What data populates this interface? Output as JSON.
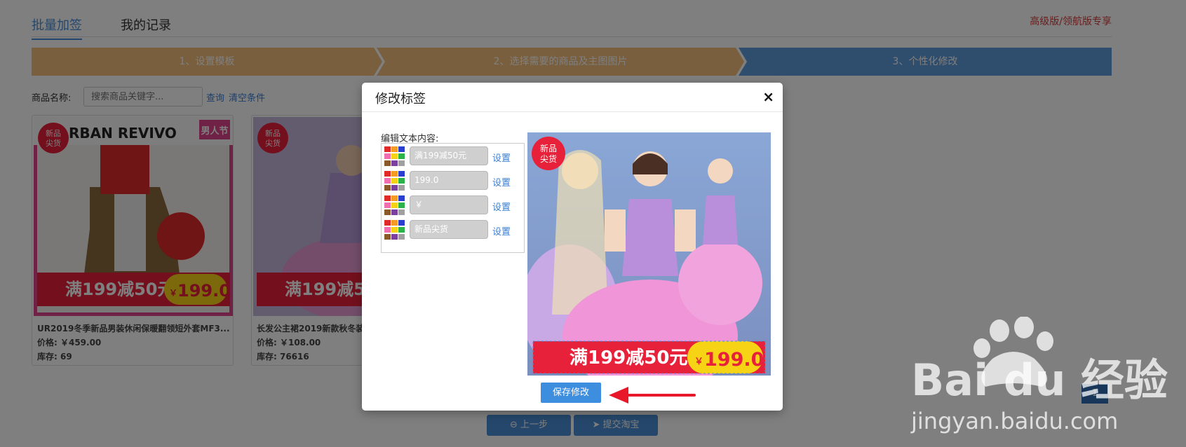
{
  "tabs": {
    "batch": "批量加签",
    "records": "我的记录",
    "edition": "高级版/领航版专享"
  },
  "steps": [
    "1、设置模板",
    "2、选择需要的商品及主图图片",
    "3、个性化修改"
  ],
  "filter": {
    "label": "商品名称:",
    "placeholder": "搜索商品关键字...",
    "query": "查询",
    "clear": "清空条件"
  },
  "products": [
    {
      "title": "UR2019冬季新品男装休闲保暖翻领短外套MF3...",
      "price": "价格: ￥459.00",
      "stock": "库存: 69",
      "brand": "RBAN REVIVO",
      "tag": "男人节"
    },
    {
      "title": "长发公主裙2019新款秋冬装",
      "price": "价格: ￥108.00",
      "stock": "库存: 76616"
    }
  ],
  "label_overlay": {
    "badge": [
      "新品",
      "尖货"
    ],
    "promo": "满199减50元",
    "yen": "￥",
    "price": "199.0"
  },
  "modal": {
    "title": "修改标签",
    "close": "×",
    "edit_label": "编辑文本内容:",
    "rows": [
      {
        "value": "满199减50元",
        "link": "设置"
      },
      {
        "value": "199.0",
        "link": "设置"
      },
      {
        "value": "￥",
        "link": "设置"
      },
      {
        "value": "新品尖货",
        "link": "设置"
      }
    ],
    "save": "保存修改"
  },
  "pagination": {
    "current": "1"
  },
  "buttons": {
    "prev": "上一步",
    "submit": "提交淘宝"
  },
  "watermark": {
    "brand": "Bai du 经验",
    "url": "jingyan.baidu.com"
  },
  "colors": {
    "accent_blue": "#4a8fd6",
    "step_orange": "#f2be7d",
    "step_blue": "#5f9bdb",
    "tag_red": "#e8213a",
    "price_yellow": "#f7d316",
    "edition_red": "#d23c3c"
  }
}
